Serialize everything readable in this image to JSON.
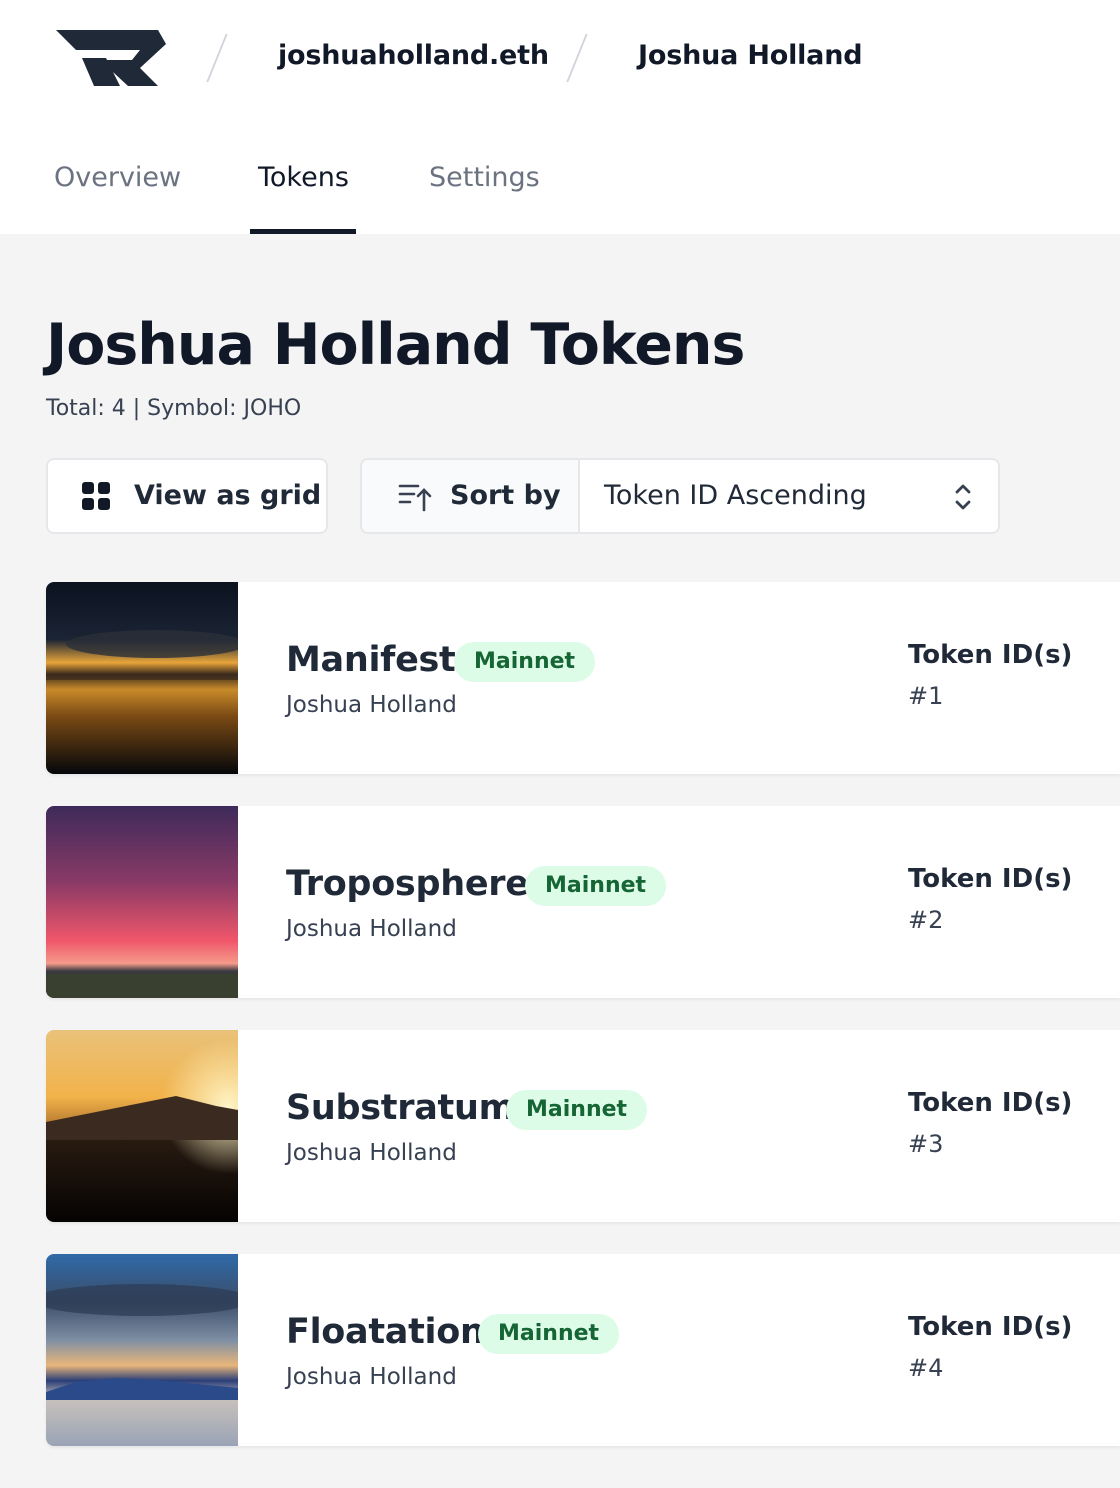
{
  "header": {
    "logo": "brand-logo-icon",
    "breadcrumbs": [
      "joshuaholland.eth",
      "Joshua Holland"
    ]
  },
  "tabs": [
    {
      "label": "Overview",
      "active": false
    },
    {
      "label": "Tokens",
      "active": true
    },
    {
      "label": "Settings",
      "active": false
    }
  ],
  "page": {
    "title": "Joshua Holland Tokens",
    "summary": "Total: 4 | Symbol: JOHO"
  },
  "controls": {
    "view_grid_label": "View as grid",
    "sort_label": "Sort by",
    "sort_value": "Token ID Ascending"
  },
  "tokens": [
    {
      "name": "Manifest",
      "network": "Mainnet",
      "artist": "Joshua Holland",
      "id_label": "Token ID(s)",
      "id": "#1"
    },
    {
      "name": "Troposphere",
      "network": "Mainnet",
      "artist": "Joshua Holland",
      "id_label": "Token ID(s)",
      "id": "#2"
    },
    {
      "name": "Substratum",
      "network": "Mainnet",
      "artist": "Joshua Holland",
      "id_label": "Token ID(s)",
      "id": "#3"
    },
    {
      "name": "Floatation",
      "network": "Mainnet",
      "artist": "Joshua Holland",
      "id_label": "Token ID(s)",
      "id": "#4"
    }
  ],
  "colors": {
    "badge_bg": "#dcfce7",
    "badge_text": "#166534",
    "text_primary": "#111827"
  }
}
